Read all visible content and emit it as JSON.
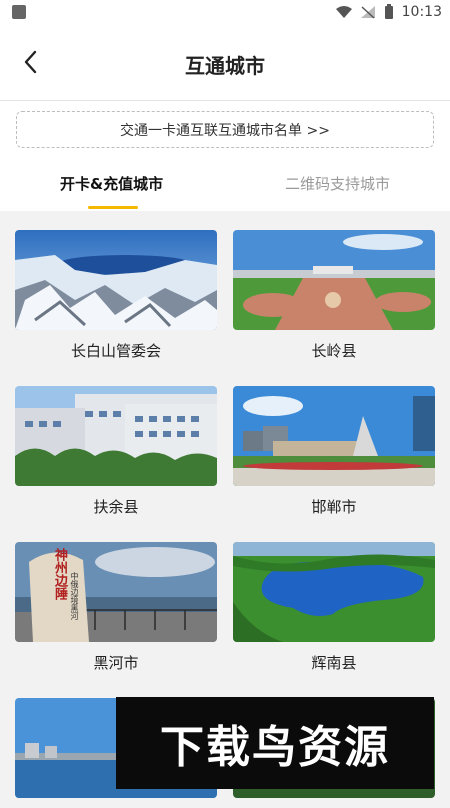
{
  "status_bar": {
    "time": "10:13"
  },
  "header": {
    "title": "互通城市"
  },
  "banner": {
    "text": "交通一卡通互联互通城市名单 >>"
  },
  "tabs": [
    {
      "label": "开卡&充值城市",
      "active": true
    },
    {
      "label": "二维码支持城市",
      "active": false
    }
  ],
  "cities": [
    {
      "name": "长白山管委会"
    },
    {
      "name": "长岭县"
    },
    {
      "name": "扶余县"
    },
    {
      "name": "邯郸市"
    },
    {
      "name": "黑河市"
    },
    {
      "name": "辉南县"
    },
    {
      "name": ""
    },
    {
      "name": ""
    }
  ],
  "stone_text": {
    "main": "神州边陲",
    "sub": "中俄边境黑河"
  },
  "watermark": {
    "text": "下载鸟资源"
  },
  "colors": {
    "accent": "#f5b800",
    "background": "#f2f2f2"
  }
}
